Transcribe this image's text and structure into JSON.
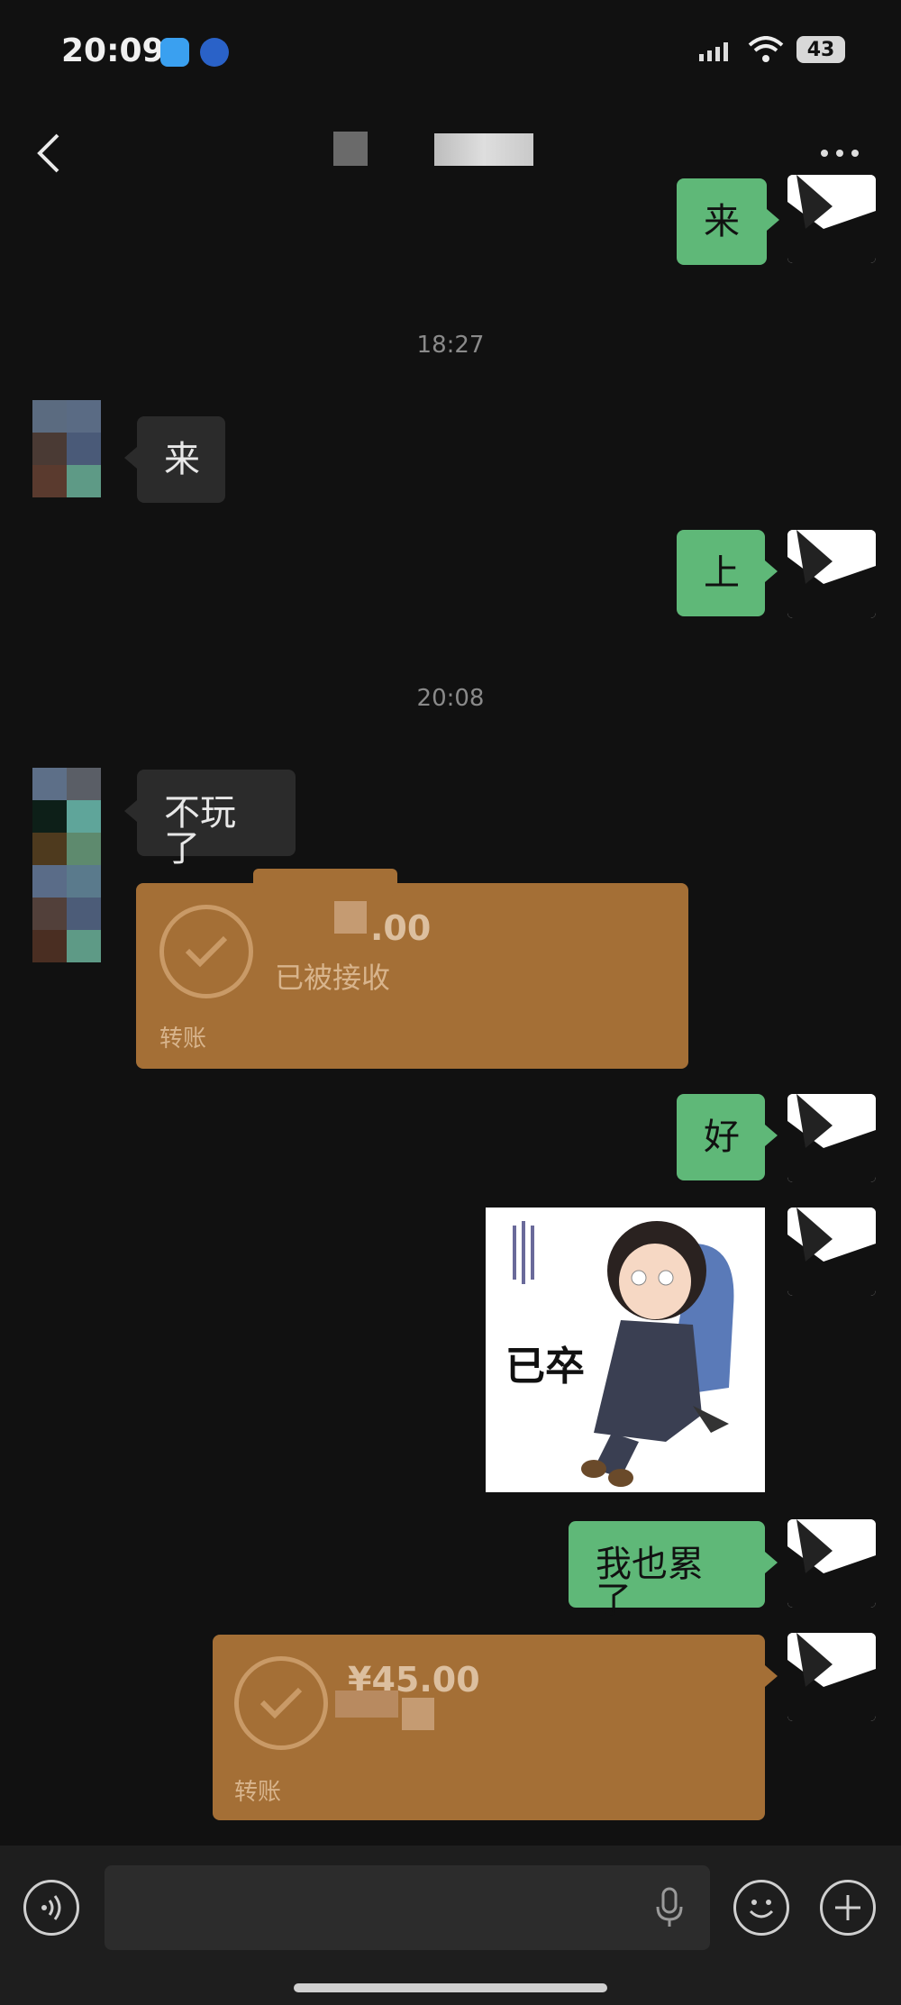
{
  "status_bar": {
    "time": "20:09",
    "battery": "43"
  },
  "chat": {
    "timestamps": [
      "18:27",
      "20:08"
    ],
    "messages": {
      "m1": "来",
      "m2": "来",
      "m3": "上",
      "m4": "不玩了",
      "m5": "好",
      "m6": "我也累了"
    },
    "transfer1": {
      "amount_partial": ".00",
      "status": "已被接收",
      "label": "转账"
    },
    "transfer2": {
      "amount_partial": "¥45.00",
      "label": "转账"
    },
    "sticker": {
      "caption": "已卒"
    }
  },
  "colors": {
    "background": "#111111",
    "outgoing_bubble": "#5fb878",
    "incoming_bubble": "#2b2b2b",
    "transfer_card": "#a46f36"
  },
  "icons": [
    "back-arrow-icon",
    "more-icon",
    "voice-icon",
    "mic-icon",
    "emoji-icon",
    "plus-icon",
    "checkmark-icon"
  ]
}
